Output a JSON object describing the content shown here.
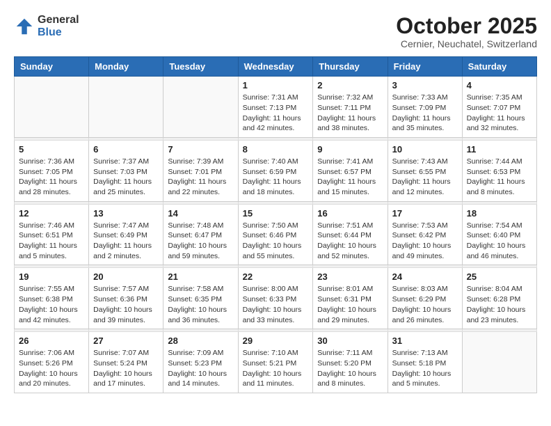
{
  "logo": {
    "general": "General",
    "blue": "Blue"
  },
  "header": {
    "month": "October 2025",
    "location": "Cernier, Neuchatel, Switzerland"
  },
  "weekdays": [
    "Sunday",
    "Monday",
    "Tuesday",
    "Wednesday",
    "Thursday",
    "Friday",
    "Saturday"
  ],
  "weeks": [
    [
      {
        "day": "",
        "info": ""
      },
      {
        "day": "",
        "info": ""
      },
      {
        "day": "",
        "info": ""
      },
      {
        "day": "1",
        "info": "Sunrise: 7:31 AM\nSunset: 7:13 PM\nDaylight: 11 hours\nand 42 minutes."
      },
      {
        "day": "2",
        "info": "Sunrise: 7:32 AM\nSunset: 7:11 PM\nDaylight: 11 hours\nand 38 minutes."
      },
      {
        "day": "3",
        "info": "Sunrise: 7:33 AM\nSunset: 7:09 PM\nDaylight: 11 hours\nand 35 minutes."
      },
      {
        "day": "4",
        "info": "Sunrise: 7:35 AM\nSunset: 7:07 PM\nDaylight: 11 hours\nand 32 minutes."
      }
    ],
    [
      {
        "day": "5",
        "info": "Sunrise: 7:36 AM\nSunset: 7:05 PM\nDaylight: 11 hours\nand 28 minutes."
      },
      {
        "day": "6",
        "info": "Sunrise: 7:37 AM\nSunset: 7:03 PM\nDaylight: 11 hours\nand 25 minutes."
      },
      {
        "day": "7",
        "info": "Sunrise: 7:39 AM\nSunset: 7:01 PM\nDaylight: 11 hours\nand 22 minutes."
      },
      {
        "day": "8",
        "info": "Sunrise: 7:40 AM\nSunset: 6:59 PM\nDaylight: 11 hours\nand 18 minutes."
      },
      {
        "day": "9",
        "info": "Sunrise: 7:41 AM\nSunset: 6:57 PM\nDaylight: 11 hours\nand 15 minutes."
      },
      {
        "day": "10",
        "info": "Sunrise: 7:43 AM\nSunset: 6:55 PM\nDaylight: 11 hours\nand 12 minutes."
      },
      {
        "day": "11",
        "info": "Sunrise: 7:44 AM\nSunset: 6:53 PM\nDaylight: 11 hours\nand 8 minutes."
      }
    ],
    [
      {
        "day": "12",
        "info": "Sunrise: 7:46 AM\nSunset: 6:51 PM\nDaylight: 11 hours\nand 5 minutes."
      },
      {
        "day": "13",
        "info": "Sunrise: 7:47 AM\nSunset: 6:49 PM\nDaylight: 11 hours\nand 2 minutes."
      },
      {
        "day": "14",
        "info": "Sunrise: 7:48 AM\nSunset: 6:47 PM\nDaylight: 10 hours\nand 59 minutes."
      },
      {
        "day": "15",
        "info": "Sunrise: 7:50 AM\nSunset: 6:46 PM\nDaylight: 10 hours\nand 55 minutes."
      },
      {
        "day": "16",
        "info": "Sunrise: 7:51 AM\nSunset: 6:44 PM\nDaylight: 10 hours\nand 52 minutes."
      },
      {
        "day": "17",
        "info": "Sunrise: 7:53 AM\nSunset: 6:42 PM\nDaylight: 10 hours\nand 49 minutes."
      },
      {
        "day": "18",
        "info": "Sunrise: 7:54 AM\nSunset: 6:40 PM\nDaylight: 10 hours\nand 46 minutes."
      }
    ],
    [
      {
        "day": "19",
        "info": "Sunrise: 7:55 AM\nSunset: 6:38 PM\nDaylight: 10 hours\nand 42 minutes."
      },
      {
        "day": "20",
        "info": "Sunrise: 7:57 AM\nSunset: 6:36 PM\nDaylight: 10 hours\nand 39 minutes."
      },
      {
        "day": "21",
        "info": "Sunrise: 7:58 AM\nSunset: 6:35 PM\nDaylight: 10 hours\nand 36 minutes."
      },
      {
        "day": "22",
        "info": "Sunrise: 8:00 AM\nSunset: 6:33 PM\nDaylight: 10 hours\nand 33 minutes."
      },
      {
        "day": "23",
        "info": "Sunrise: 8:01 AM\nSunset: 6:31 PM\nDaylight: 10 hours\nand 29 minutes."
      },
      {
        "day": "24",
        "info": "Sunrise: 8:03 AM\nSunset: 6:29 PM\nDaylight: 10 hours\nand 26 minutes."
      },
      {
        "day": "25",
        "info": "Sunrise: 8:04 AM\nSunset: 6:28 PM\nDaylight: 10 hours\nand 23 minutes."
      }
    ],
    [
      {
        "day": "26",
        "info": "Sunrise: 7:06 AM\nSunset: 5:26 PM\nDaylight: 10 hours\nand 20 minutes."
      },
      {
        "day": "27",
        "info": "Sunrise: 7:07 AM\nSunset: 5:24 PM\nDaylight: 10 hours\nand 17 minutes."
      },
      {
        "day": "28",
        "info": "Sunrise: 7:09 AM\nSunset: 5:23 PM\nDaylight: 10 hours\nand 14 minutes."
      },
      {
        "day": "29",
        "info": "Sunrise: 7:10 AM\nSunset: 5:21 PM\nDaylight: 10 hours\nand 11 minutes."
      },
      {
        "day": "30",
        "info": "Sunrise: 7:11 AM\nSunset: 5:20 PM\nDaylight: 10 hours\nand 8 minutes."
      },
      {
        "day": "31",
        "info": "Sunrise: 7:13 AM\nSunset: 5:18 PM\nDaylight: 10 hours\nand 5 minutes."
      },
      {
        "day": "",
        "info": ""
      }
    ]
  ]
}
